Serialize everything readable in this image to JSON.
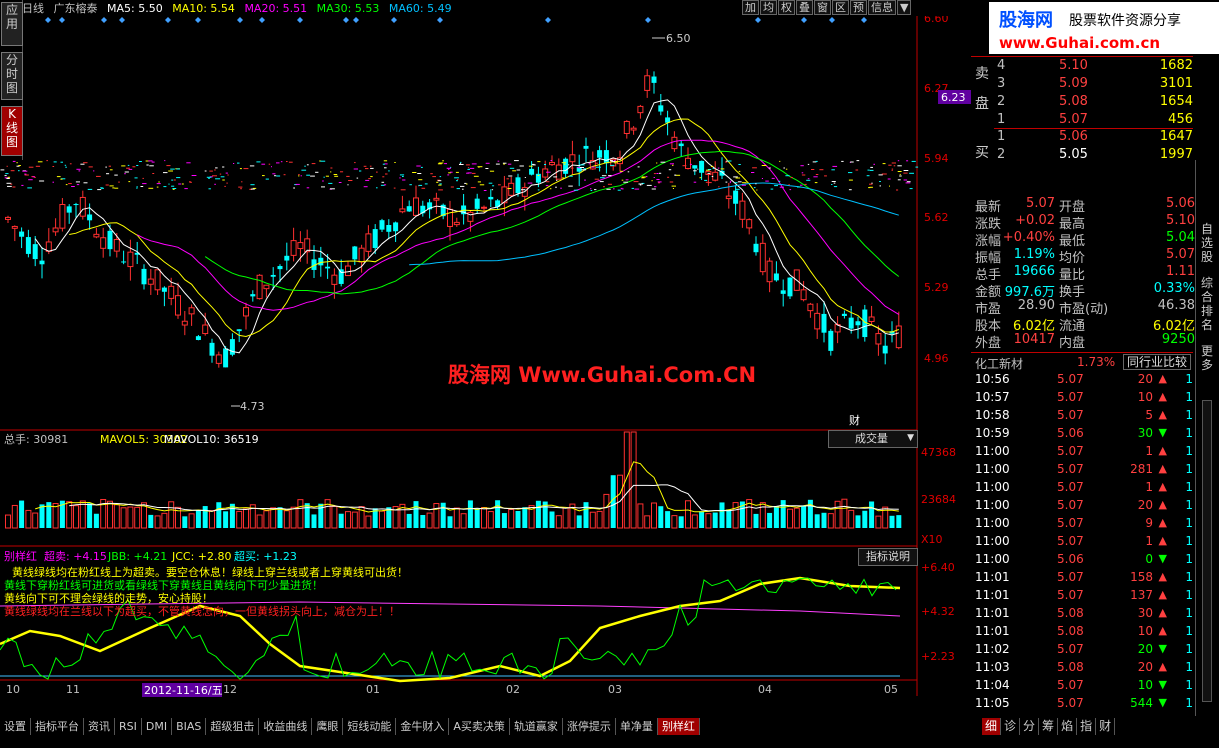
{
  "left_sidebar": {
    "buttons": [
      {
        "label": "应用"
      },
      {
        "label": "分时图"
      },
      {
        "label": "K线图"
      }
    ]
  },
  "header": {
    "period": "日线",
    "stock_name": "广东榕泰",
    "ma": [
      {
        "label": "MA5: 5.50",
        "color": "#ffffff"
      },
      {
        "label": "MA10: 5.54",
        "color": "#ffff00"
      },
      {
        "label": "MA20: 5.51",
        "color": "#ff00ff"
      },
      {
        "label": "MA30: 5.53",
        "color": "#00ff00"
      },
      {
        "label": "MA60: 5.49",
        "color": "#00c0ff"
      }
    ]
  },
  "toolbar": {
    "buttons": [
      "加",
      "均",
      "权",
      "叠",
      "窗",
      "区",
      "预",
      "信息"
    ]
  },
  "price_axis": [
    "6.60",
    "6.27",
    "5.94",
    "5.62",
    "5.29",
    "4.96"
  ],
  "current_price_tag": "6.23",
  "annotations": {
    "high": "6.50",
    "low": "4.73",
    "finance_marker": "财"
  },
  "watermark": "股海网 Www.Guhai.Com.CN",
  "volume_panel": {
    "label": "总手: 30981",
    "mavol5": "MAVOL5: 30302",
    "mavol10": "MAVOL10: 36519",
    "dropdown": "成交量",
    "axis": [
      "47368",
      "23684",
      "X10"
    ]
  },
  "indicator_panel": {
    "name": "别样红",
    "s1": "超卖: +4.15",
    "s2": "JBB: +4.21",
    "s3": "JCC: +2.80",
    "s4": "超买: +1.23",
    "desc_button": "指标说明",
    "notes": [
      "黄线绿线均在粉红线上为超卖。要空仓休息！绿线上穿兰线或者上穿黄线可出货！",
      "黄线下穿粉红线可进货或看绿线下穿黄线且黄线向下可少量进货！",
      "黄线向下可不理会绿线的走势，安心持股！",
      "黄线绿线均在兰线以下为超买，不管黄线怎向，一但黄线拐头向上，减仓为上！！"
    ],
    "axis": [
      "+6.40",
      "+4.32",
      "+2.23"
    ]
  },
  "date_axis": {
    "labels": [
      "10",
      "11",
      "01",
      "02",
      "03",
      "04",
      "05"
    ],
    "cursor_date": "2012-11-16/五",
    "after": "12"
  },
  "bottom_tabs": [
    "设置",
    "指标平台",
    "资讯",
    "RSI",
    "DMI",
    "BIAS",
    "超级狙击",
    "收益曲线",
    "鹰眼",
    "短线动能",
    "金牛财入",
    "A买卖决策",
    "轨道赢家",
    "涨停提示",
    "单净量",
    "别样红"
  ],
  "banner": {
    "logo": "股海网",
    "tagline": "股票软件资源分享",
    "url": "www.Guhai.com.cn"
  },
  "order_book": {
    "sell_label": "卖盘",
    "buy_label": "买盘",
    "sells": [
      {
        "n": "4",
        "price": "5.10",
        "vol": "1682"
      },
      {
        "n": "3",
        "price": "5.09",
        "vol": "3101"
      },
      {
        "n": "2",
        "price": "5.08",
        "vol": "1654"
      },
      {
        "n": "1",
        "price": "5.07",
        "vol": "456"
      }
    ],
    "buys": [
      {
        "n": "1",
        "price": "5.06",
        "vol": "1647"
      },
      {
        "n": "2",
        "price": "5.05",
        "vol": "1997"
      }
    ]
  },
  "quote": [
    {
      "l1": "最新",
      "v1": "5.07",
      "c1": "#ff4040",
      "l2": "开盘",
      "v2": "5.06",
      "c2": "#ff4040"
    },
    {
      "l1": "涨跌",
      "v1": "+0.02",
      "c1": "#ff4040",
      "l2": "最高",
      "v2": "5.10",
      "c2": "#ff4040"
    },
    {
      "l1": "涨幅",
      "v1": "+0.40%",
      "c1": "#ff4040",
      "l2": "最低",
      "v2": "5.04",
      "c2": "#00ff00"
    },
    {
      "l1": "振幅",
      "v1": "1.19%",
      "c1": "#00ffff",
      "l2": "均价",
      "v2": "5.07",
      "c2": "#ff4040"
    },
    {
      "l1": "总手",
      "v1": "19666",
      "c1": "#00ffff",
      "l2": "量比",
      "v2": "1.11",
      "c2": "#ff4040"
    },
    {
      "l1": "金额",
      "v1": "997.6万",
      "c1": "#00ffff",
      "l2": "换手",
      "v2": "0.33%",
      "c2": "#00ffff"
    },
    {
      "l1": "市盈",
      "v1": "28.90",
      "c1": "#c0c0c0",
      "l2": "市盈(动)",
      "v2": "46.38",
      "c2": "#c0c0c0"
    },
    {
      "l1": "股本",
      "v1": "6.02亿",
      "c1": "#ffff00",
      "l2": "流通",
      "v2": "6.02亿",
      "c2": "#ffff00"
    },
    {
      "l1": "外盘",
      "v1": "10417",
      "c1": "#ff4040",
      "l2": "内盘",
      "v2": "9250",
      "c2": "#00ff00"
    }
  ],
  "industry": {
    "name": "化工新材",
    "pct": "1.73%",
    "compare_button": "同行业比较"
  },
  "trades": [
    {
      "t": "10:56",
      "p": "5.07",
      "pc": "#ff4040",
      "v": "20",
      "dir": "up",
      "n": "1"
    },
    {
      "t": "10:57",
      "p": "5.07",
      "pc": "#ff4040",
      "v": "10",
      "dir": "up",
      "n": "1"
    },
    {
      "t": "10:58",
      "p": "5.07",
      "pc": "#ff4040",
      "v": "5",
      "dir": "up",
      "n": "1"
    },
    {
      "t": "10:59",
      "p": "5.06",
      "pc": "#ff4040",
      "v": "30",
      "dir": "down",
      "n": "1"
    },
    {
      "t": "11:00",
      "p": "5.07",
      "pc": "#ff4040",
      "v": "1",
      "dir": "up",
      "n": "1"
    },
    {
      "t": "11:00",
      "p": "5.07",
      "pc": "#ff4040",
      "v": "281",
      "dir": "up",
      "n": "1"
    },
    {
      "t": "11:00",
      "p": "5.07",
      "pc": "#ff4040",
      "v": "1",
      "dir": "up",
      "n": "1"
    },
    {
      "t": "11:00",
      "p": "5.07",
      "pc": "#ff4040",
      "v": "20",
      "dir": "up",
      "n": "1"
    },
    {
      "t": "11:00",
      "p": "5.07",
      "pc": "#ff4040",
      "v": "9",
      "dir": "up",
      "n": "1"
    },
    {
      "t": "11:00",
      "p": "5.07",
      "pc": "#ff4040",
      "v": "1",
      "dir": "up",
      "n": "1"
    },
    {
      "t": "11:00",
      "p": "5.06",
      "pc": "#ff4040",
      "v": "0",
      "dir": "down",
      "n": "1"
    },
    {
      "t": "11:01",
      "p": "5.07",
      "pc": "#ff4040",
      "v": "158",
      "dir": "up",
      "n": "1"
    },
    {
      "t": "11:01",
      "p": "5.07",
      "pc": "#ff4040",
      "v": "137",
      "dir": "up",
      "n": "1"
    },
    {
      "t": "11:01",
      "p": "5.08",
      "pc": "#ff4040",
      "v": "30",
      "dir": "up",
      "n": "1"
    },
    {
      "t": "11:01",
      "p": "5.08",
      "pc": "#ff4040",
      "v": "10",
      "dir": "up",
      "n": "1"
    },
    {
      "t": "11:02",
      "p": "5.07",
      "pc": "#ff4040",
      "v": "20",
      "dir": "down",
      "n": "1"
    },
    {
      "t": "11:03",
      "p": "5.08",
      "pc": "#ff4040",
      "v": "20",
      "dir": "up",
      "n": "1"
    },
    {
      "t": "11:04",
      "p": "5.07",
      "pc": "#ff4040",
      "v": "10",
      "dir": "down",
      "n": "1"
    },
    {
      "t": "11:05",
      "p": "5.07",
      "pc": "#ff4040",
      "v": "544",
      "dir": "down",
      "n": "1"
    }
  ],
  "right_edge_tabs": [
    "自选股",
    "综合排名",
    "更多"
  ],
  "right_bottom_tabs": [
    "细",
    "诊",
    "分",
    "筹",
    "焰",
    "指",
    "财"
  ],
  "colors": {
    "up": "#ff3030",
    "down": "#00ffff",
    "axis": "#c00000",
    "ma5": "#ffffff",
    "ma10": "#ffff00",
    "ma20": "#ff00ff",
    "ma30": "#00ff00",
    "ma60": "#00c0ff"
  }
}
